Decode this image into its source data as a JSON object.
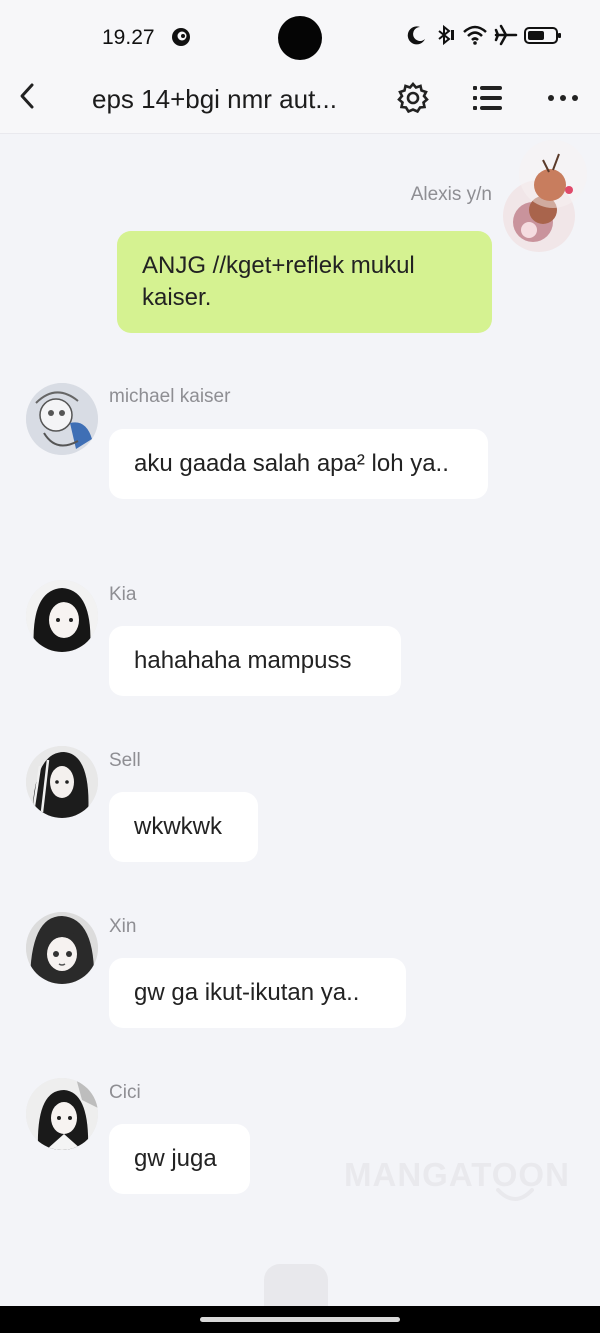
{
  "status_bar": {
    "time": "19.27",
    "icons": [
      "swirl-app-icon",
      "moon-icon",
      "bluetooth-icon",
      "wifi-icon",
      "airplane-icon",
      "battery-icon"
    ]
  },
  "header": {
    "title": "eps 14+bgi nmr aut...",
    "icons": [
      "back-icon",
      "settings-icon",
      "list-icon",
      "more-icon"
    ]
  },
  "messages": [
    {
      "sender": "Alexis y/n",
      "text": "ANJG //kget+reflek mukul kaiser.",
      "direction": "outgoing"
    },
    {
      "sender": "michael kaiser",
      "text": "aku gaada salah apa² loh ya..",
      "direction": "incoming"
    },
    {
      "sender": "Kia",
      "text": "hahahaha mampuss",
      "direction": "incoming"
    },
    {
      "sender": "Sell",
      "text": "wkwkwk",
      "direction": "incoming"
    },
    {
      "sender": "Xin",
      "text": "gw ga ikut-ikutan ya..",
      "direction": "incoming"
    },
    {
      "sender": "Cici",
      "text": "gw juga",
      "direction": "incoming"
    }
  ],
  "watermark": "MANGATOON",
  "colors": {
    "background": "#f3f4f8",
    "outgoing_bubble": "#d5f291",
    "incoming_bubble": "#ffffff",
    "sender_name": "#8e8e93"
  }
}
